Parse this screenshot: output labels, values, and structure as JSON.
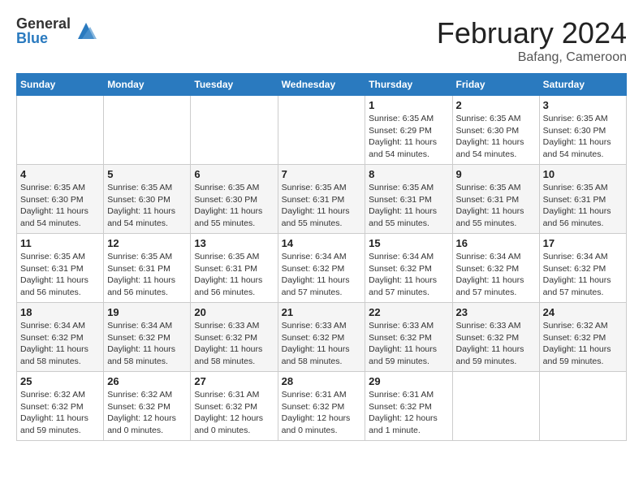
{
  "header": {
    "logo_general": "General",
    "logo_blue": "Blue",
    "month_title": "February 2024",
    "location": "Bafang, Cameroon"
  },
  "calendar": {
    "days_of_week": [
      "Sunday",
      "Monday",
      "Tuesday",
      "Wednesday",
      "Thursday",
      "Friday",
      "Saturday"
    ],
    "weeks": [
      [
        {
          "day": "",
          "info": ""
        },
        {
          "day": "",
          "info": ""
        },
        {
          "day": "",
          "info": ""
        },
        {
          "day": "",
          "info": ""
        },
        {
          "day": "1",
          "info": "Sunrise: 6:35 AM\nSunset: 6:29 PM\nDaylight: 11 hours\nand 54 minutes."
        },
        {
          "day": "2",
          "info": "Sunrise: 6:35 AM\nSunset: 6:30 PM\nDaylight: 11 hours\nand 54 minutes."
        },
        {
          "day": "3",
          "info": "Sunrise: 6:35 AM\nSunset: 6:30 PM\nDaylight: 11 hours\nand 54 minutes."
        }
      ],
      [
        {
          "day": "4",
          "info": "Sunrise: 6:35 AM\nSunset: 6:30 PM\nDaylight: 11 hours\nand 54 minutes."
        },
        {
          "day": "5",
          "info": "Sunrise: 6:35 AM\nSunset: 6:30 PM\nDaylight: 11 hours\nand 54 minutes."
        },
        {
          "day": "6",
          "info": "Sunrise: 6:35 AM\nSunset: 6:30 PM\nDaylight: 11 hours\nand 55 minutes."
        },
        {
          "day": "7",
          "info": "Sunrise: 6:35 AM\nSunset: 6:31 PM\nDaylight: 11 hours\nand 55 minutes."
        },
        {
          "day": "8",
          "info": "Sunrise: 6:35 AM\nSunset: 6:31 PM\nDaylight: 11 hours\nand 55 minutes."
        },
        {
          "day": "9",
          "info": "Sunrise: 6:35 AM\nSunset: 6:31 PM\nDaylight: 11 hours\nand 55 minutes."
        },
        {
          "day": "10",
          "info": "Sunrise: 6:35 AM\nSunset: 6:31 PM\nDaylight: 11 hours\nand 56 minutes."
        }
      ],
      [
        {
          "day": "11",
          "info": "Sunrise: 6:35 AM\nSunset: 6:31 PM\nDaylight: 11 hours\nand 56 minutes."
        },
        {
          "day": "12",
          "info": "Sunrise: 6:35 AM\nSunset: 6:31 PM\nDaylight: 11 hours\nand 56 minutes."
        },
        {
          "day": "13",
          "info": "Sunrise: 6:35 AM\nSunset: 6:31 PM\nDaylight: 11 hours\nand 56 minutes."
        },
        {
          "day": "14",
          "info": "Sunrise: 6:34 AM\nSunset: 6:32 PM\nDaylight: 11 hours\nand 57 minutes."
        },
        {
          "day": "15",
          "info": "Sunrise: 6:34 AM\nSunset: 6:32 PM\nDaylight: 11 hours\nand 57 minutes."
        },
        {
          "day": "16",
          "info": "Sunrise: 6:34 AM\nSunset: 6:32 PM\nDaylight: 11 hours\nand 57 minutes."
        },
        {
          "day": "17",
          "info": "Sunrise: 6:34 AM\nSunset: 6:32 PM\nDaylight: 11 hours\nand 57 minutes."
        }
      ],
      [
        {
          "day": "18",
          "info": "Sunrise: 6:34 AM\nSunset: 6:32 PM\nDaylight: 11 hours\nand 58 minutes."
        },
        {
          "day": "19",
          "info": "Sunrise: 6:34 AM\nSunset: 6:32 PM\nDaylight: 11 hours\nand 58 minutes."
        },
        {
          "day": "20",
          "info": "Sunrise: 6:33 AM\nSunset: 6:32 PM\nDaylight: 11 hours\nand 58 minutes."
        },
        {
          "day": "21",
          "info": "Sunrise: 6:33 AM\nSunset: 6:32 PM\nDaylight: 11 hours\nand 58 minutes."
        },
        {
          "day": "22",
          "info": "Sunrise: 6:33 AM\nSunset: 6:32 PM\nDaylight: 11 hours\nand 59 minutes."
        },
        {
          "day": "23",
          "info": "Sunrise: 6:33 AM\nSunset: 6:32 PM\nDaylight: 11 hours\nand 59 minutes."
        },
        {
          "day": "24",
          "info": "Sunrise: 6:32 AM\nSunset: 6:32 PM\nDaylight: 11 hours\nand 59 minutes."
        }
      ],
      [
        {
          "day": "25",
          "info": "Sunrise: 6:32 AM\nSunset: 6:32 PM\nDaylight: 11 hours\nand 59 minutes."
        },
        {
          "day": "26",
          "info": "Sunrise: 6:32 AM\nSunset: 6:32 PM\nDaylight: 12 hours\nand 0 minutes."
        },
        {
          "day": "27",
          "info": "Sunrise: 6:31 AM\nSunset: 6:32 PM\nDaylight: 12 hours\nand 0 minutes."
        },
        {
          "day": "28",
          "info": "Sunrise: 6:31 AM\nSunset: 6:32 PM\nDaylight: 12 hours\nand 0 minutes."
        },
        {
          "day": "29",
          "info": "Sunrise: 6:31 AM\nSunset: 6:32 PM\nDaylight: 12 hours\nand 1 minute."
        },
        {
          "day": "",
          "info": ""
        },
        {
          "day": "",
          "info": ""
        }
      ]
    ]
  }
}
